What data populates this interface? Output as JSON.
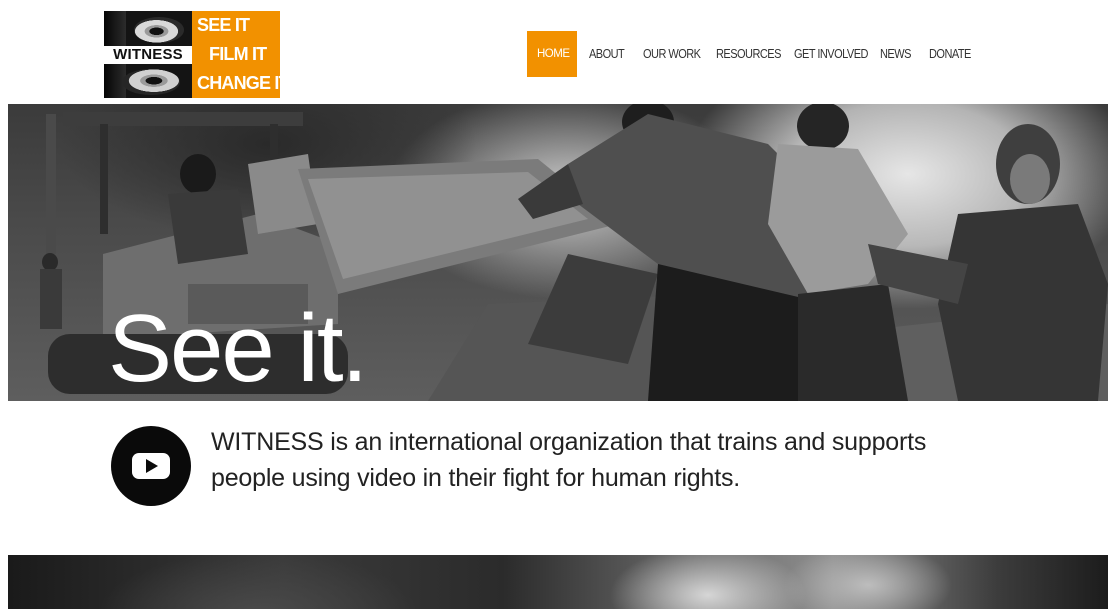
{
  "logo": {
    "wordmark": "WITNESS",
    "tagline": [
      "SEE IT",
      "FILM IT",
      "CHANGE IT"
    ],
    "accent_color": "#f29100"
  },
  "nav": {
    "items": [
      {
        "label": "HOME",
        "active": true
      },
      {
        "label": "ABOUT",
        "active": false
      },
      {
        "label": "OUR WORK",
        "active": false
      },
      {
        "label": "RESOURCES",
        "active": false
      },
      {
        "label": "GET INVOLVED",
        "active": false
      },
      {
        "label": "NEWS",
        "active": false
      },
      {
        "label": "DONATE",
        "active": false
      }
    ]
  },
  "hero": {
    "title": "See it."
  },
  "intro": {
    "icon": "video-play-icon",
    "text": "WITNESS is an international organization that trains and supports people using video in their fight for human rights."
  }
}
